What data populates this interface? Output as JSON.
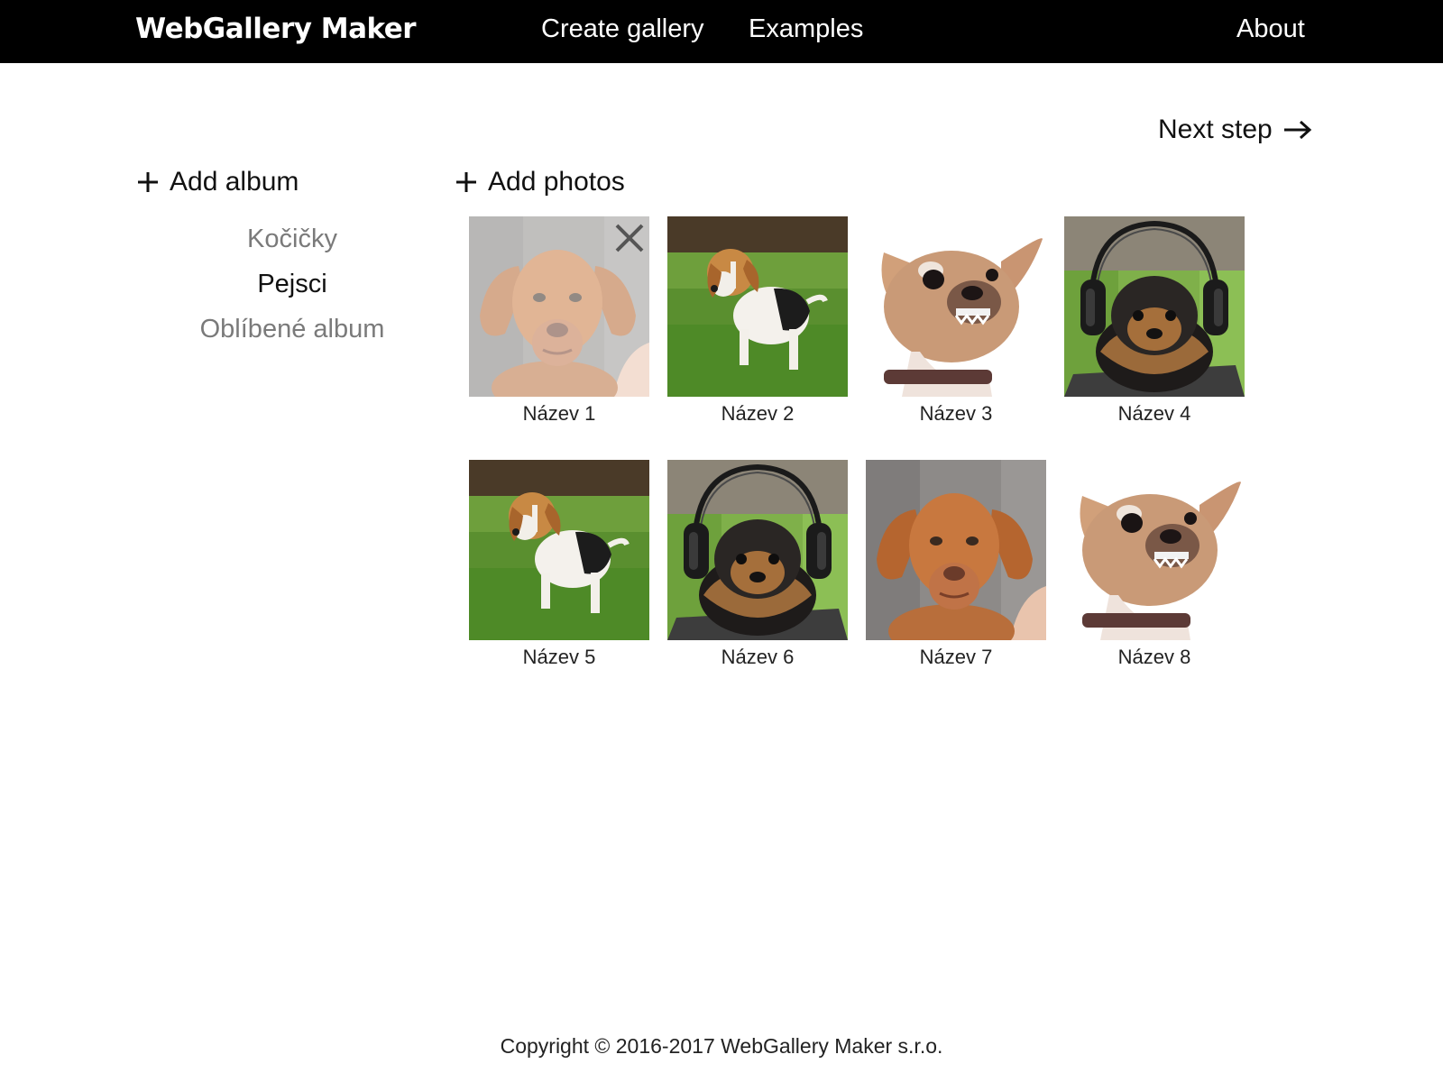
{
  "header": {
    "brand": "WebGallery Maker",
    "nav": {
      "create_gallery": "Create gallery",
      "examples": "Examples",
      "about": "About"
    }
  },
  "actions": {
    "next_step": "Next step",
    "add_album": "Add album",
    "add_photos": "Add photos"
  },
  "albums": [
    {
      "label": "Kočičky",
      "active": false
    },
    {
      "label": "Pejsci",
      "active": true
    },
    {
      "label": "Oblíbené album",
      "active": false
    }
  ],
  "photos": [
    {
      "caption": "Název 1",
      "subject": "vizsla-puppy",
      "hovered": true
    },
    {
      "caption": "Název 2",
      "subject": "beagle-puppy",
      "hovered": false
    },
    {
      "caption": "Název 3",
      "subject": "chihuahua",
      "hovered": false
    },
    {
      "caption": "Název 4",
      "subject": "yorkie-headphones",
      "hovered": false
    },
    {
      "caption": "Název 5",
      "subject": "beagle-puppy",
      "hovered": false
    },
    {
      "caption": "Název 6",
      "subject": "yorkie-headphones",
      "hovered": false
    },
    {
      "caption": "Název 7",
      "subject": "vizsla-puppy",
      "hovered": false
    },
    {
      "caption": "Název 8",
      "subject": "chihuahua",
      "hovered": false
    }
  ],
  "footer": {
    "copyright": "Copyright © 2016-2017 WebGallery Maker s.r.o."
  },
  "icons": {
    "add": "plus-icon",
    "next": "arrow-right-icon",
    "remove": "close-icon"
  },
  "colors": {
    "header_bg": "#000000",
    "header_text": "#ffffff",
    "inactive_album": "#7a7a7a",
    "active_album": "#111111"
  }
}
